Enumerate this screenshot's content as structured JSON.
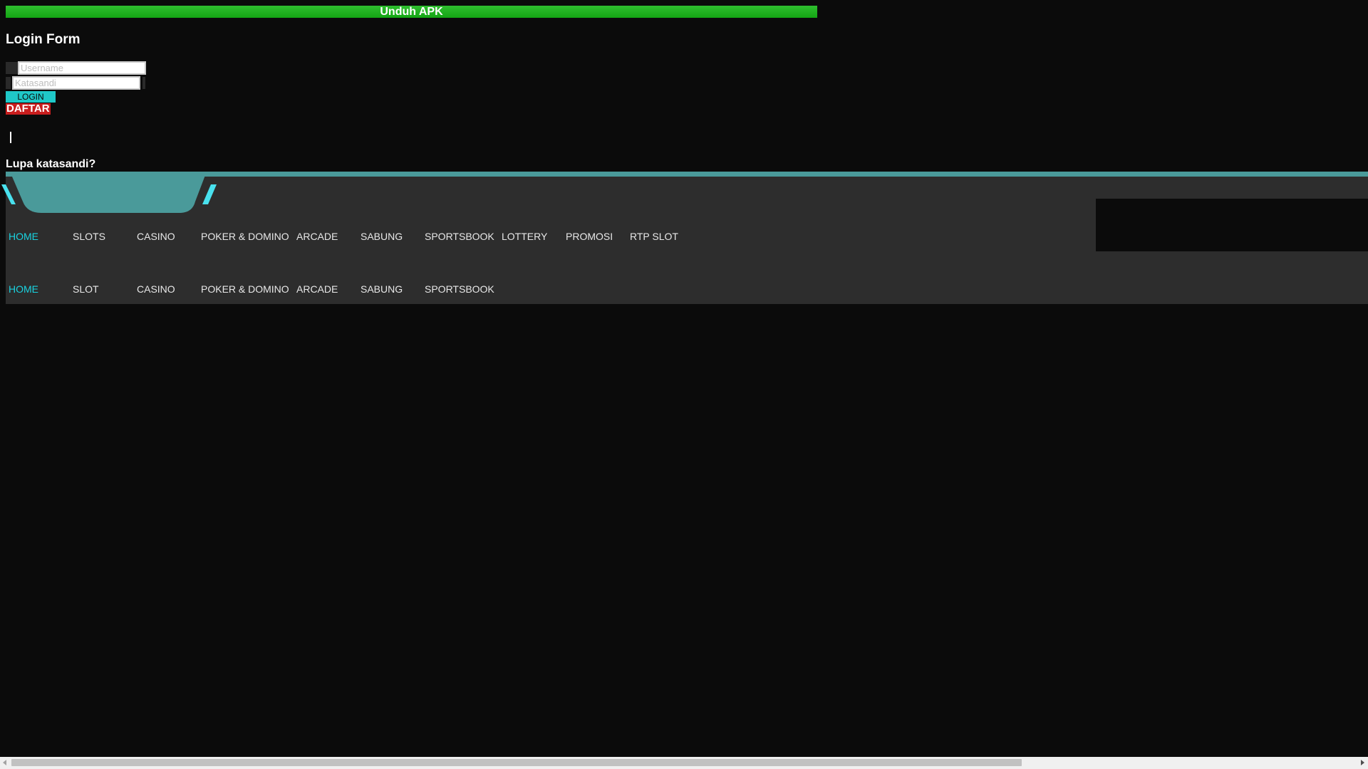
{
  "download_bar": {
    "label": "Unduh APK"
  },
  "login_form": {
    "title": "Login Form",
    "username_placeholder": "Username",
    "password_placeholder": "Katasandi",
    "login_label": "LOGIN",
    "register_label": "DAFTAR",
    "forgot_label": "Lupa katasandi?"
  },
  "nav": {
    "primary": [
      {
        "label": "HOME",
        "active": true
      },
      {
        "label": "SLOTS"
      },
      {
        "label": "CASINO"
      },
      {
        "label": "POKER & DOMINO"
      },
      {
        "label": "ARCADE"
      },
      {
        "label": "SABUNG"
      },
      {
        "label": "SPORTSBOOK"
      },
      {
        "label": "LOTTERY"
      },
      {
        "label": "PROMOSI"
      },
      {
        "label": "RTP SLOT"
      }
    ],
    "secondary": [
      {
        "label": "HOME",
        "active": true
      },
      {
        "label": "SLOT"
      },
      {
        "label": "CASINO"
      },
      {
        "label": "POKER & DOMINO"
      },
      {
        "label": "ARCADE"
      },
      {
        "label": "SABUNG"
      },
      {
        "label": "SPORTSBOOK"
      }
    ]
  },
  "colors": {
    "accent": "#19d3e0",
    "download_green": "#14a514",
    "register_red": "#c81e1e",
    "login_teal": "#1fc8c8",
    "nav_bg": "#2d2d2d",
    "page_bg": "#0b0b0b"
  }
}
